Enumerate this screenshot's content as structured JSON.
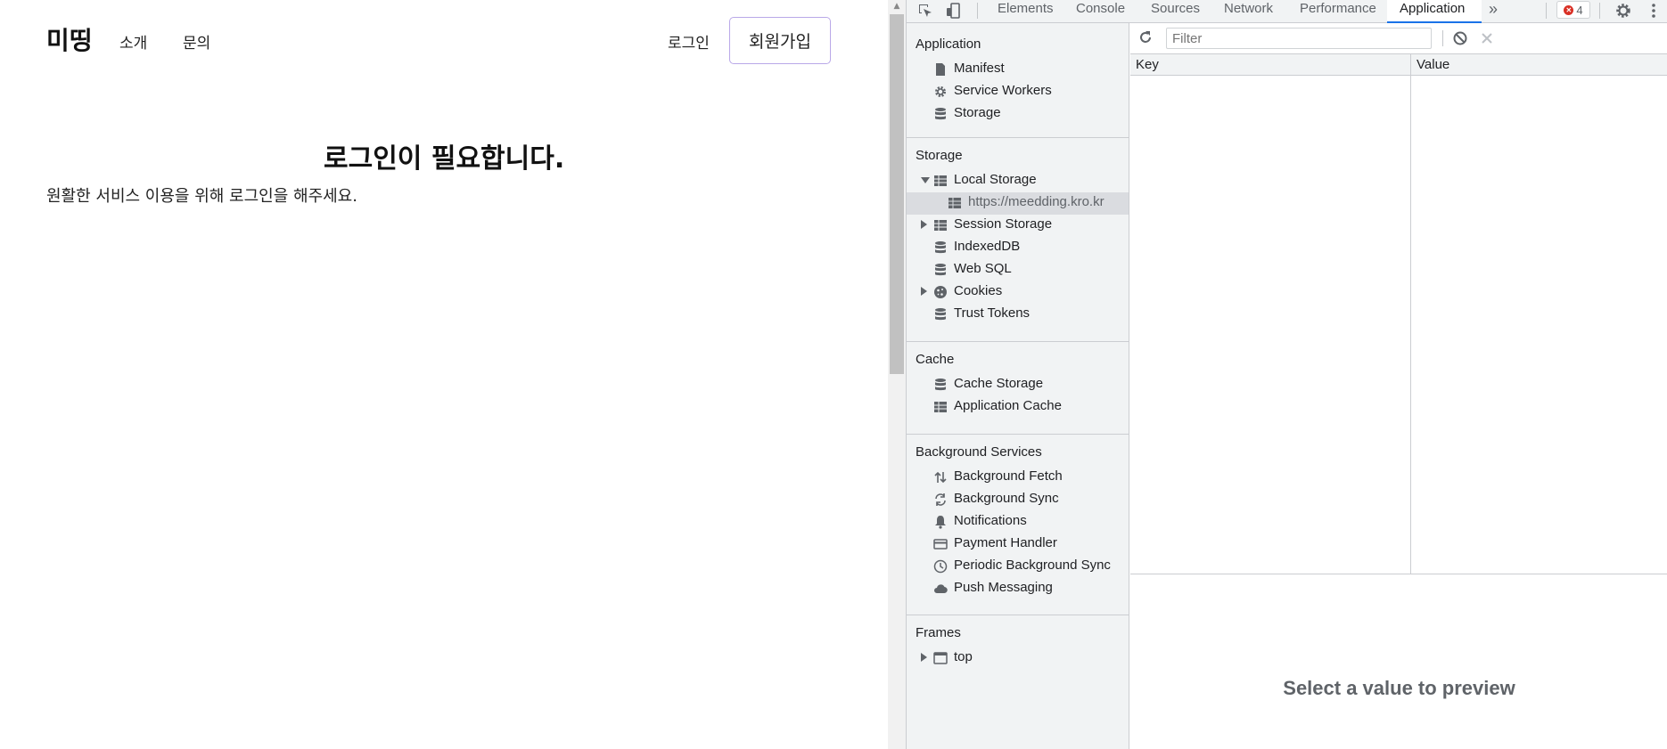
{
  "site": {
    "logo": "미띵",
    "nav": [
      "소개",
      "문의"
    ],
    "login": "로그인",
    "signup": "회원가입",
    "heading": "로그인이 필요합니다.",
    "subtext": "원활한 서비스 이용을 위해 로그인을 해주세요."
  },
  "devtools": {
    "tabs": [
      "Elements",
      "Console",
      "Sources",
      "Network",
      "Performance",
      "Application"
    ],
    "active_tab": "Application",
    "more_tabs_icon": "chevron-double-right-icon",
    "error_count": "4",
    "sidebar": {
      "application": {
        "title": "Application",
        "items": [
          {
            "label": "Manifest",
            "icon": "file-icon"
          },
          {
            "label": "Service Workers",
            "icon": "gear-icon"
          },
          {
            "label": "Storage",
            "icon": "database-icon"
          }
        ]
      },
      "storage": {
        "title": "Storage",
        "items": [
          {
            "label": "Local Storage",
            "icon": "table-icon",
            "expanded": true
          },
          {
            "label": "https://meedding.kro.kr",
            "icon": "table-icon",
            "selected": true
          },
          {
            "label": "Session Storage",
            "icon": "table-icon",
            "expanded": false
          },
          {
            "label": "IndexedDB",
            "icon": "database-icon"
          },
          {
            "label": "Web SQL",
            "icon": "database-icon"
          },
          {
            "label": "Cookies",
            "icon": "cookie-icon",
            "expanded": false
          },
          {
            "label": "Trust Tokens",
            "icon": "database-icon"
          }
        ]
      },
      "cache": {
        "title": "Cache",
        "items": [
          {
            "label": "Cache Storage",
            "icon": "database-icon"
          },
          {
            "label": "Application Cache",
            "icon": "table-icon"
          }
        ]
      },
      "background": {
        "title": "Background Services",
        "items": [
          {
            "label": "Background Fetch",
            "icon": "arrows-updown-icon"
          },
          {
            "label": "Background Sync",
            "icon": "sync-icon"
          },
          {
            "label": "Notifications",
            "icon": "bell-icon"
          },
          {
            "label": "Payment Handler",
            "icon": "credit-card-icon"
          },
          {
            "label": "Periodic Background Sync",
            "icon": "clock-icon"
          },
          {
            "label": "Push Messaging",
            "icon": "cloud-icon"
          }
        ]
      },
      "frames": {
        "title": "Frames",
        "items": [
          {
            "label": "top",
            "icon": "window-icon",
            "expanded": false
          }
        ]
      }
    },
    "main": {
      "filter_placeholder": "Filter",
      "columns": [
        "Key",
        "Value"
      ],
      "preview_text": "Select a value to preview"
    }
  }
}
